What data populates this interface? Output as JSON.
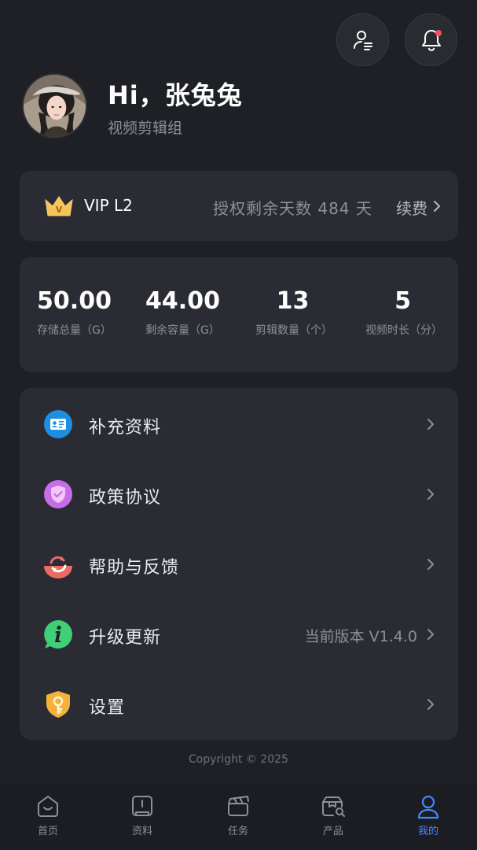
{
  "header": {
    "greeting": "Hi，张兔兔",
    "department": "视频剪辑组"
  },
  "vip": {
    "level": "VIP L2",
    "remaining": "授权剩余天数 484 天",
    "renew": "续费"
  },
  "stats": [
    {
      "value": "50.00",
      "label": "存储总量（G）"
    },
    {
      "value": "44.00",
      "label": "剩余容量（G）"
    },
    {
      "value": "13",
      "label": "剪辑数量（个）"
    },
    {
      "value": "5",
      "label": "视频时长（分）"
    }
  ],
  "menu": [
    {
      "label": "补充资料",
      "icon": "id-card-icon",
      "color": "#1e8fe0"
    },
    {
      "label": "政策协议",
      "icon": "shield-icon",
      "color": "#c86de8"
    },
    {
      "label": "帮助与反馈",
      "icon": "refresh-icon",
      "color": "#ec6a64"
    },
    {
      "label": "升级更新",
      "icon": "info-icon",
      "color": "#3fcf77",
      "extra": "当前版本 V1.4.0"
    },
    {
      "label": "设置",
      "icon": "key-icon",
      "color": "#f5b23a"
    }
  ],
  "footer": {
    "copyright": "Copyright © 2025"
  },
  "tabbar": [
    {
      "label": "首页",
      "icon": "home-icon"
    },
    {
      "label": "资料",
      "icon": "document-icon"
    },
    {
      "label": "任务",
      "icon": "clapperboard-icon"
    },
    {
      "label": "产品",
      "icon": "product-search-icon"
    },
    {
      "label": "我的",
      "icon": "user-icon",
      "active": true
    }
  ],
  "colors": {
    "background": "#1f2025",
    "card": "#2b2c33",
    "accent": "#3d8bff"
  }
}
